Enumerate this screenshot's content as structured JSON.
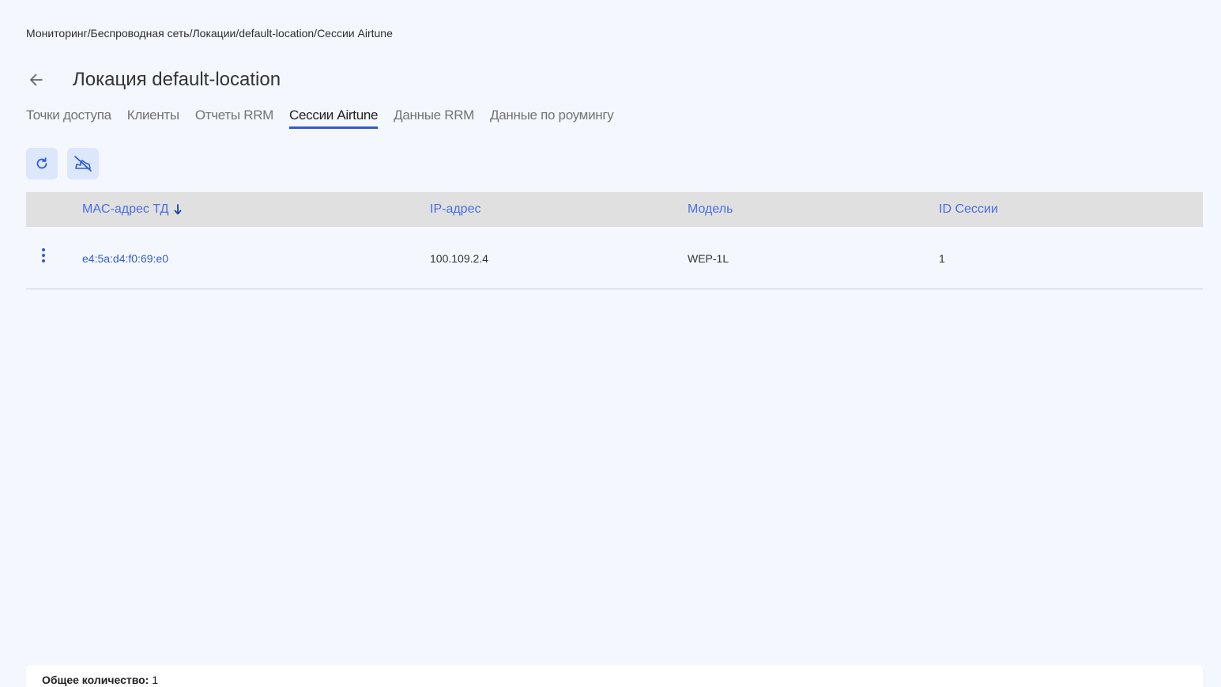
{
  "breadcrumb": {
    "text": "Мониторинг/Беспроводная сеть/Локации/default-location/Сессии Airtune"
  },
  "header": {
    "title": "Локация default-location",
    "back_icon": "arrow-left-icon"
  },
  "tabs": [
    {
      "label": "Точки доступа",
      "active": false
    },
    {
      "label": "Клиенты",
      "active": false
    },
    {
      "label": "Отчеты RRM",
      "active": false
    },
    {
      "label": "Сессии Airtune",
      "active": true
    },
    {
      "label": "Данные RRM",
      "active": false
    },
    {
      "label": "Данные по роумингу",
      "active": false
    }
  ],
  "toolbar": {
    "refresh_icon": "refresh-icon",
    "disconnect_icon": "cloud-off-icon"
  },
  "table": {
    "columns": [
      "MAC-адрес ТД",
      "IP-адрес",
      "Модель",
      "ID Сессии"
    ],
    "sort_column": "MAC-адрес ТД",
    "sort_direction": "desc",
    "rows": [
      {
        "mac": "e4:5a:d4:f0:69:e0",
        "ip": "100.109.2.4",
        "model": "WEP-1L",
        "session_id": "1"
      }
    ]
  },
  "footer": {
    "total_label": "Общее количество:",
    "total_value": "1"
  },
  "colors": {
    "accent": "#2f5bd1",
    "header_text": "#4a6fe0",
    "background": "#f4f7fd",
    "table_header_bg": "#e0e0e0",
    "button_bg": "#dde7fb"
  }
}
